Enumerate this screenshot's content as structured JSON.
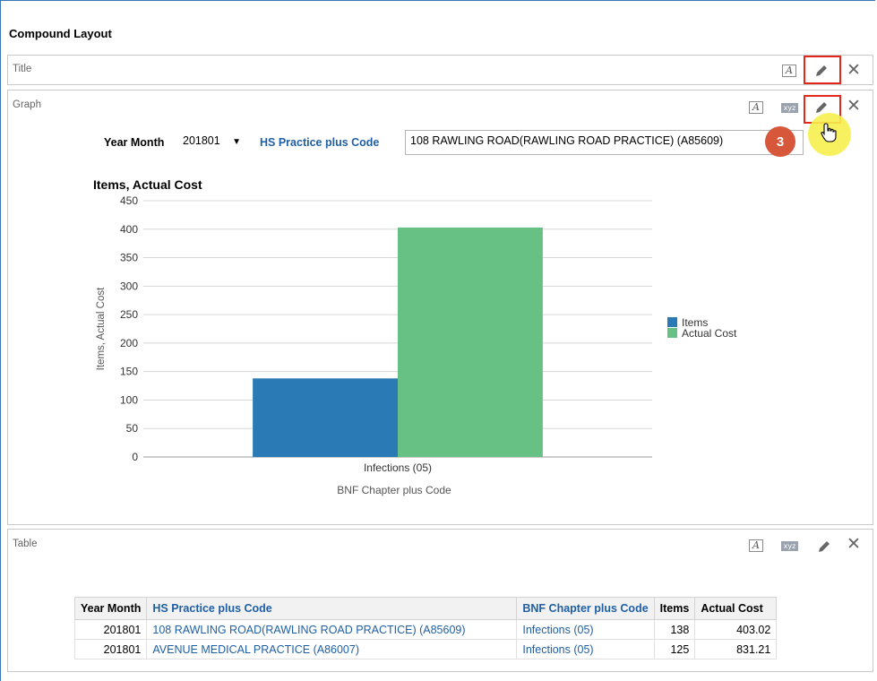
{
  "layout": {
    "title": "Compound Layout"
  },
  "views": {
    "title_view": {
      "label": "Title"
    },
    "graph_view": {
      "label": "Graph"
    },
    "table_view": {
      "label": "Table"
    }
  },
  "toolbar": {
    "format_glyph": "A",
    "xyz_glyph": "xyz",
    "close_glyph": "✕"
  },
  "prompts": {
    "year_month": {
      "label": "Year Month",
      "value": "201801"
    },
    "practice": {
      "label": "HS Practice plus Code",
      "value": "108 RAWLING ROAD(RAWLING ROAD PRACTICE) (A85609)"
    }
  },
  "step_badge": "3",
  "colors": {
    "items": "#2a7ab5",
    "actual_cost": "#67c185",
    "link": "#1f5fa5",
    "highlight": "#e2271d"
  },
  "chart_data": {
    "type": "bar",
    "title": "Items, Actual Cost",
    "xlabel": "BNF Chapter plus Code",
    "ylabel": "Items, Actual Cost",
    "categories": [
      "Infections (05)"
    ],
    "series": [
      {
        "name": "Items",
        "values": [
          138
        ]
      },
      {
        "name": "Actual Cost",
        "values": [
          403.02
        ]
      }
    ],
    "ylim": [
      0,
      450
    ],
    "yticks": [
      0,
      50,
      100,
      150,
      200,
      250,
      300,
      350,
      400,
      450
    ],
    "grid": true,
    "legend": "right"
  },
  "table": {
    "headers": [
      "Year Month",
      "HS Practice plus Code",
      "BNF Chapter plus Code",
      "Items",
      "Actual Cost"
    ],
    "rows": [
      [
        "201801",
        "108 RAWLING ROAD(RAWLING ROAD PRACTICE) (A85609)",
        "Infections (05)",
        "138",
        "403.02"
      ],
      [
        "201801",
        "AVENUE MEDICAL PRACTICE (A86007)",
        "Infections (05)",
        "125",
        "831.21"
      ]
    ]
  }
}
